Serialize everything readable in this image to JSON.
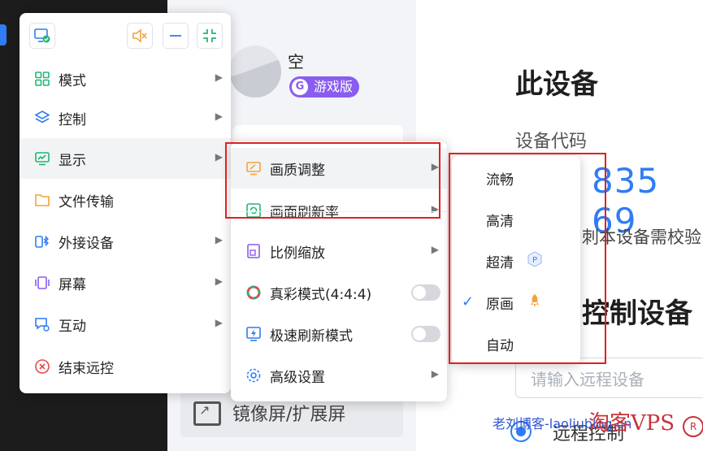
{
  "background": {
    "username": "空",
    "edition_badge": {
      "icon_letter": "G",
      "label": "游戏版"
    },
    "device_section_title": "此设备",
    "device_code_label": "设备代码",
    "device_code_value": "835 69",
    "verify_hint": "刺本设备需校验",
    "control_section_title": "控制设备",
    "remote_input_placeholder": "请输入远程设备",
    "remote_option_label": "远程控制",
    "mirror_button_label": "镜像屏/扩展屏"
  },
  "toolbar": {
    "screen_icon": "monitor-check-icon",
    "mute_icon": "speaker-muted-icon",
    "minimize_icon": "minus-icon",
    "collapse_icon": "collapse-icon",
    "accent_color": "#f3a33a",
    "primary_color": "#2f7cf6"
  },
  "main_menu": {
    "items": [
      {
        "label": "模式",
        "icon": "grid-icon",
        "has_submenu": true
      },
      {
        "label": "控制",
        "icon": "layers-icon",
        "has_submenu": true
      },
      {
        "label": "显示",
        "icon": "chart-screen-icon",
        "has_submenu": true
      },
      {
        "label": "文件传输",
        "icon": "folder-icon",
        "has_submenu": false
      },
      {
        "label": "外接设备",
        "icon": "bluetooth-device-icon",
        "has_submenu": true
      },
      {
        "label": "屏幕",
        "icon": "screens-icon",
        "has_submenu": true
      },
      {
        "label": "互动",
        "icon": "chat-icon",
        "has_submenu": true
      },
      {
        "label": "结束远控",
        "icon": "close-circle-icon",
        "has_submenu": false
      }
    ]
  },
  "display_menu": {
    "items": [
      {
        "label": "画质调整",
        "icon": "quality-icon",
        "has_submenu": true
      },
      {
        "label": "画面刷新率",
        "icon": "refresh-screen-icon",
        "has_submenu": true
      },
      {
        "label": "比例缩放",
        "icon": "scale-icon",
        "has_submenu": true
      },
      {
        "label": "真彩模式(4:4:4)",
        "icon": "color-wheel-icon",
        "toggle": false
      },
      {
        "label": "极速刷新模式",
        "icon": "lightning-screen-icon",
        "toggle": false
      },
      {
        "label": "高级设置",
        "icon": "gear-icon",
        "has_submenu": true
      }
    ]
  },
  "quality_menu": {
    "items": [
      {
        "label": "流畅",
        "selected": false
      },
      {
        "label": "高清",
        "selected": false
      },
      {
        "label": "超清",
        "selected": false,
        "badge": "P"
      },
      {
        "label": "原画",
        "selected": true,
        "badge": "rocket-icon"
      },
      {
        "label": "自动",
        "selected": false
      }
    ]
  },
  "watermark": {
    "site_text": "老刘博客-laoliublog.cn",
    "brand_text": "淘客VPS",
    "mark": "R"
  }
}
